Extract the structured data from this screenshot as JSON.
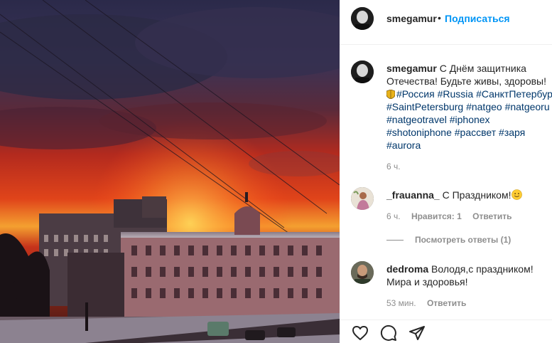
{
  "post": {
    "username": "smegamur",
    "separator": "•",
    "follow_label": "Подписаться"
  },
  "caption": {
    "username": "smegamur",
    "line1": "С Днём защитника",
    "line2": "Отечества! Будьте живы, здоровы!",
    "hashtags_line1": [
      "#Россия",
      "#Russia",
      "#СанктПетербург"
    ],
    "hashtags_line2": [
      "#SaintPetersburg",
      "#natgeo",
      "#natgeoru"
    ],
    "hashtags_line3": [
      "#natgeotravel",
      "#iphonex"
    ],
    "hashtags_line4": [
      "#shotoniphone",
      "#рассвет",
      "#заря"
    ],
    "hashtags_line5": [
      "#aurora"
    ],
    "time": "6 ч."
  },
  "comments": [
    {
      "username": "_frauanna_",
      "text": "С Праздником!",
      "time": "6 ч.",
      "likes": "Нравится: 1",
      "reply": "Ответить",
      "view_replies": "Посмотреть ответы (1)"
    },
    {
      "username": "dedroma",
      "text_line1": "Володя,с праздником!",
      "text_line2": "Мира и здоровья!",
      "time": "53 мин.",
      "reply": "Ответить"
    }
  ],
  "icons": {
    "like": "heart-icon",
    "comment": "comment-icon",
    "share": "share-icon",
    "comment_like": "small-heart-icon",
    "caption_emoji": "shield-emoji",
    "comment_emoji": "smiley-emoji"
  },
  "colors": {
    "link": "#0095f6",
    "hashtag": "#00376b",
    "muted": "#8e8e8e"
  }
}
